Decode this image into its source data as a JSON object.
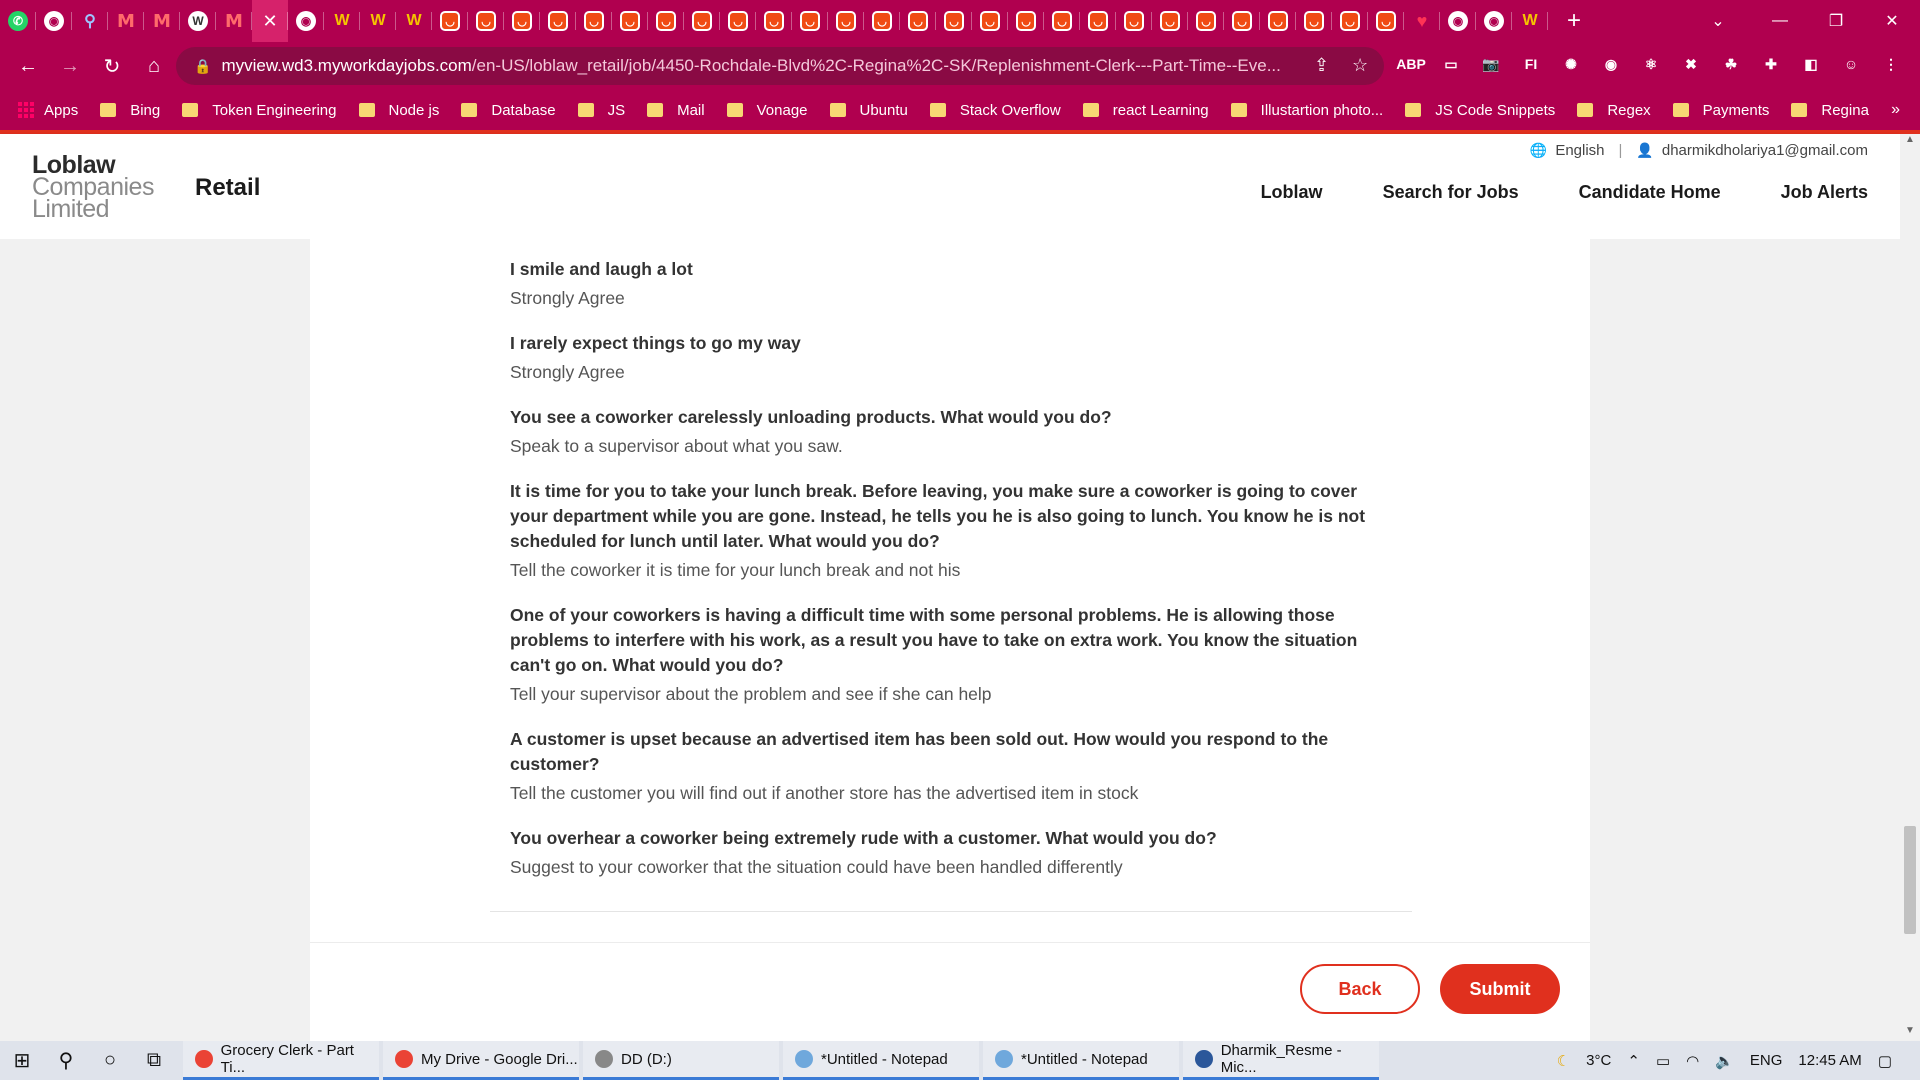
{
  "browser": {
    "tabs": [
      {
        "icon": "whatsapp-icon",
        "glyph": "✆",
        "kind": "wa"
      },
      {
        "icon": "globe-icon",
        "glyph": "◉",
        "kind": "globe"
      },
      {
        "icon": "search-icon",
        "glyph": "⚲",
        "kind": "search"
      },
      {
        "icon": "gmail-icon",
        "glyph": "M",
        "kind": "gmail"
      },
      {
        "icon": "gmail-icon",
        "glyph": "M",
        "kind": "gmail"
      },
      {
        "icon": "wordpress-icon",
        "glyph": "W",
        "kind": "wp"
      },
      {
        "icon": "gmail-icon",
        "glyph": "M",
        "kind": "gmail"
      },
      {
        "icon": "close-icon",
        "glyph": "✕",
        "kind": "active"
      },
      {
        "icon": "globe-icon",
        "glyph": "◉",
        "kind": "globe"
      },
      {
        "icon": "workday-icon",
        "glyph": "W",
        "kind": "wd"
      },
      {
        "icon": "workday-icon",
        "glyph": "W",
        "kind": "wd"
      },
      {
        "icon": "workday-icon",
        "glyph": "W",
        "kind": "wd"
      },
      {
        "icon": "smile-icon",
        "glyph": "◡",
        "kind": "red"
      },
      {
        "icon": "smile-icon",
        "glyph": "◡",
        "kind": "red"
      },
      {
        "icon": "smile-icon",
        "glyph": "◡",
        "kind": "red"
      },
      {
        "icon": "smile-icon",
        "glyph": "◡",
        "kind": "red"
      },
      {
        "icon": "smile-icon",
        "glyph": "◡",
        "kind": "red"
      },
      {
        "icon": "smile-icon",
        "glyph": "◡",
        "kind": "red"
      },
      {
        "icon": "smile-icon",
        "glyph": "◡",
        "kind": "red"
      },
      {
        "icon": "smile-icon",
        "glyph": "◡",
        "kind": "red"
      },
      {
        "icon": "smile-icon",
        "glyph": "◡",
        "kind": "red"
      },
      {
        "icon": "smile-icon",
        "glyph": "◡",
        "kind": "red"
      },
      {
        "icon": "smile-icon",
        "glyph": "◡",
        "kind": "red"
      },
      {
        "icon": "smile-icon",
        "glyph": "◡",
        "kind": "red"
      },
      {
        "icon": "smile-icon",
        "glyph": "◡",
        "kind": "red"
      },
      {
        "icon": "smile-icon",
        "glyph": "◡",
        "kind": "red"
      },
      {
        "icon": "smile-icon",
        "glyph": "◡",
        "kind": "red"
      },
      {
        "icon": "smile-icon",
        "glyph": "◡",
        "kind": "red"
      },
      {
        "icon": "smile-icon",
        "glyph": "◡",
        "kind": "red"
      },
      {
        "icon": "smile-icon",
        "glyph": "◡",
        "kind": "red"
      },
      {
        "icon": "smile-icon",
        "glyph": "◡",
        "kind": "red"
      },
      {
        "icon": "smile-icon",
        "glyph": "◡",
        "kind": "red"
      },
      {
        "icon": "smile-icon",
        "glyph": "◡",
        "kind": "red"
      },
      {
        "icon": "smile-icon",
        "glyph": "◡",
        "kind": "red"
      },
      {
        "icon": "smile-icon",
        "glyph": "◡",
        "kind": "red"
      },
      {
        "icon": "smile-icon",
        "glyph": "◡",
        "kind": "red"
      },
      {
        "icon": "smile-icon",
        "glyph": "◡",
        "kind": "red"
      },
      {
        "icon": "smile-icon",
        "glyph": "◡",
        "kind": "red"
      },
      {
        "icon": "smile-icon",
        "glyph": "◡",
        "kind": "red"
      },
      {
        "icon": "heart-icon",
        "glyph": "♥",
        "kind": "heart"
      },
      {
        "icon": "globe-icon",
        "glyph": "◉",
        "kind": "globe"
      },
      {
        "icon": "globe-icon",
        "glyph": "◉",
        "kind": "globe"
      },
      {
        "icon": "workday-icon",
        "glyph": "W",
        "kind": "wd"
      }
    ],
    "new_tab": "+",
    "url_host": "myview.wd3.myworkdayjobs.com",
    "url_path": "/en-US/loblaw_retail/job/4450-Rochdale-Blvd%2C-Regina%2C-SK/Replenishment-Clerk---Part-Time--Eve...",
    "bookmarks": [
      "Apps",
      "Bing",
      "Token Engineering",
      "Node js",
      "Database",
      "JS",
      "Mail",
      "Vonage",
      "Ubuntu",
      "Stack Overflow",
      "react Learning",
      "Illustartion photo...",
      "JS Code Snippets",
      "Regex",
      "Payments",
      "Regina"
    ],
    "more_bookmarks": "»",
    "extensions": [
      "ABP",
      "▭",
      "📷",
      "FI",
      "✺",
      "◉",
      "⚛",
      "✖",
      "☘",
      "✚",
      "◧",
      "☺",
      "⋮"
    ]
  },
  "header": {
    "logo": {
      "line1": "Loblaw",
      "line2": "Companies",
      "line3": "Limited"
    },
    "site_title": "Retail",
    "language": "English",
    "separator": "|",
    "user_email": "dharmikdholariya1@gmail.com",
    "nav": [
      "Loblaw",
      "Search for Jobs",
      "Candidate Home",
      "Job Alerts"
    ]
  },
  "review": {
    "items": [
      {
        "question": "I smile and laugh a lot",
        "answer": "Strongly Agree"
      },
      {
        "question": "I rarely expect things to go my way",
        "answer": "Strongly Agree"
      },
      {
        "question": "You see a coworker carelessly unloading products. What would you do?",
        "answer": "Speak to a supervisor about what you saw."
      },
      {
        "question": "It is time for you to take your lunch break. Before leaving, you make sure a coworker is going to cover your department while you are gone. Instead, he tells you he is also going to lunch. You know he is not scheduled for lunch until later. What would you do?",
        "answer": "Tell the coworker it is time for your lunch break and not his"
      },
      {
        "question": "One of your coworkers is having a difficult time with some personal problems. He is allowing those problems to interfere with his work, as a result you have to take on extra work. You know the situation can't go on. What would you do?",
        "answer": "Tell your supervisor about the problem and see if she can help"
      },
      {
        "question": "A customer is upset because an advertised item has been sold out. How would you respond to the customer?",
        "answer": "Tell the customer you will find out if another store has the advertised item in stock"
      },
      {
        "question": "You overhear a coworker being extremely rude with a customer. What would you do?",
        "answer": "Suggest to your coworker that the situation could have been handled differently"
      }
    ]
  },
  "actions": {
    "back": "Back",
    "submit": "Submit"
  },
  "taskbar": {
    "tasks": [
      "Grocery Clerk - Part Ti...",
      "My Drive - Google Dri...",
      "DD (D:)",
      "*Untitled - Notepad",
      "*Untitled - Notepad",
      "Dharmik_Resme - Mic..."
    ],
    "weather": "3°C",
    "language": "ENG",
    "time": "12:45 AM"
  },
  "colors": {
    "brand": "#b0004f",
    "accent": "#e0301e"
  }
}
